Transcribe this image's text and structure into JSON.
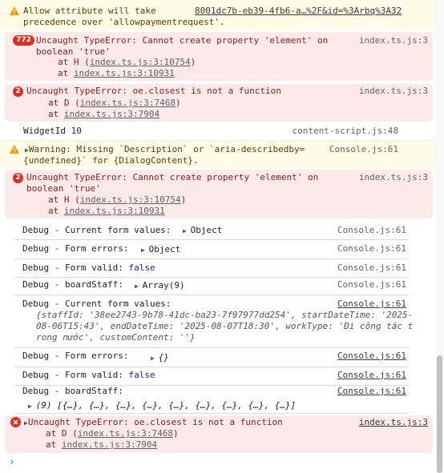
{
  "messages": {
    "allow_attr": {
      "line1": "Allow attribute will take",
      "line2": "precedence over 'allowpaymentrequest'.",
      "source": "8001dc7b-eb39-4fb6-a…%2F&id=%3Arbq%3A32"
    },
    "err1": {
      "count": "772",
      "line1": "Uncaught TypeError: Cannot create property 'element' on",
      "line2": "boolean 'true'",
      "source": "index.ts.js:3",
      "stack": [
        {
          "prefix": "at H (",
          "link": "index.ts.js:3:10754",
          "suffix": ")"
        },
        {
          "prefix": "at ",
          "link": "index.ts.js:3:10931",
          "suffix": ""
        }
      ]
    },
    "err2": {
      "count": "2",
      "line1": "Uncaught TypeError: oe.closest is not a function",
      "source": "index.ts.js:3",
      "stack": [
        {
          "prefix": "at D (",
          "link": "index.ts.js:3:7468",
          "suffix": ")"
        },
        {
          "prefix": "at ",
          "link": "index.ts.js:3:7904",
          "suffix": ""
        }
      ]
    },
    "widget": {
      "label": "WidgetId",
      "value": "10",
      "source": "content-script.js:48"
    },
    "warn_desc": {
      "line1": "Warning: Missing `Description` or `aria-describedby=",
      "line2": "{undefined}` for {DialogContent}.",
      "source": "Console.js:61"
    },
    "err3": {
      "count": "2",
      "line1": "Uncaught TypeError: Cannot create property 'element' on",
      "line2": "boolean 'true'",
      "source": "index.ts.js:3",
      "stack": [
        {
          "prefix": "at H (",
          "link": "index.ts.js:3:10754",
          "suffix": ")"
        },
        {
          "prefix": "at ",
          "link": "index.ts.js:3:10931",
          "suffix": ""
        }
      ]
    },
    "debug": [
      {
        "label": "Debug - Current form values:",
        "value": "Object",
        "source": "Console.js:61"
      },
      {
        "label": "Debug - Form errors:",
        "value": "Object",
        "source": "Console.js:61"
      },
      {
        "label": "Debug - Form valid:",
        "value": "false",
        "source": "Console.js:61"
      },
      {
        "label": "Debug - boardStaff:",
        "value": "Array(9)",
        "source": "Console.js:61"
      }
    ],
    "debug_expanded": {
      "label": "Debug - Current form values:",
      "source": "Console.js:61",
      "obj_line1": "{staffId: '38ee2743-9b78-41dc-ba23-7f97977dd254', startDateTime: '2025-",
      "obj_line2": "08-06T15:43', endDateTime: '2025-08-07T18:30', workType: 'Đi công tác t",
      "obj_line3": "rong nước', customContent: ''}"
    },
    "debug2": [
      {
        "label": "Debug - Form errors:",
        "value": "{}",
        "source": "Console.js:61"
      },
      {
        "label": "Debug - Form valid:",
        "value": "false",
        "source": "Console.js:61"
      },
      {
        "label": "Debug - boardStaff:",
        "source": "Console.js:61",
        "array": "(9) [{…}, {…}, {…}, {…}, {…}, {…}, {…}, {…}, {…}]"
      }
    ],
    "err4": {
      "line1": "Uncaught TypeError: oe.closest is not a function",
      "source": "index.ts.js:3",
      "stack": [
        {
          "prefix": "at D (",
          "link": "index.ts.js:3:7468",
          "suffix": ")"
        },
        {
          "prefix": "at ",
          "link": "index.ts.js:3:7904",
          "suffix": ""
        }
      ]
    }
  },
  "prompt": {
    "symbol": "›"
  },
  "colors": {
    "warning_bg": "#fffbe6",
    "error_bg": "#fce9e9",
    "error_red": "#d93025",
    "warn_yellow": "#f29900"
  }
}
